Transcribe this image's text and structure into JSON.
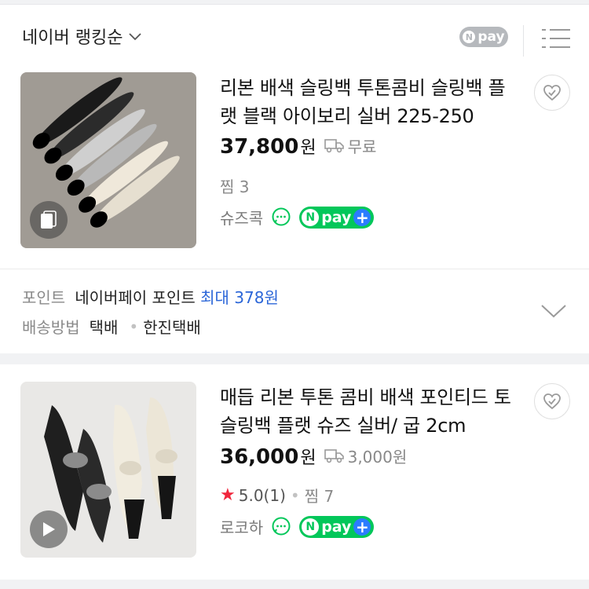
{
  "header": {
    "sort_label": "네이버 랭킹순",
    "npay_filter_label": "pay"
  },
  "products": [
    {
      "title": "리본 배색 슬링백 투톤콤비 슬링백 플랫 블랙 아이보리 실버 225-250",
      "price": "37,800",
      "price_unit": "원",
      "shipping": "무료",
      "wish": "찜 3",
      "seller": "슈즈콕",
      "npay_label": "pay"
    },
    {
      "title": "매듭 리본 투톤 콤비 배색 포인티드 토 슬링백 플랫 슈즈 실버/ 굽 2cm",
      "price": "36,000",
      "price_unit": "원",
      "shipping": "3,000원",
      "rating_star": "★",
      "rating": "5.0",
      "review_count": "(1)",
      "wish": "찜 7",
      "seller": "로코하",
      "npay_label": "pay"
    }
  ],
  "info": {
    "point_label": "포인트",
    "point_value": "네이버페이 포인트",
    "point_highlight": "최대 378원",
    "delivery_label": "배송방법",
    "delivery_value": "택배",
    "delivery_carrier": "한진택배"
  },
  "colors": {
    "npay_green": "#03c75a",
    "npay_plus_blue": "#2b7cff",
    "star_red": "#f0263c",
    "link_blue": "#2b66d8"
  }
}
